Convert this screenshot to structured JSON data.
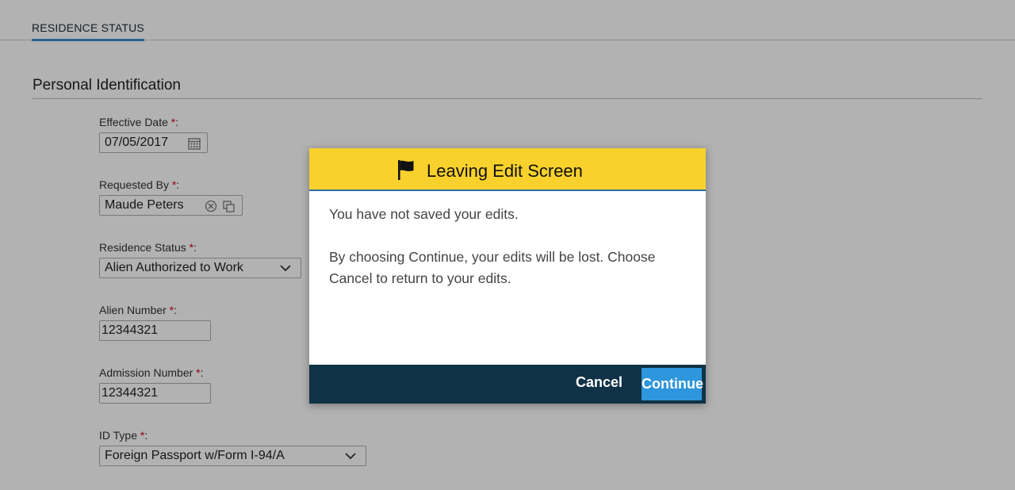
{
  "tabs": {
    "active": "RESIDENCE STATUS"
  },
  "section": {
    "title": "Personal Identification"
  },
  "form": {
    "effective_date": {
      "label": "Effective Date",
      "req": "*",
      "colon": ":",
      "value": "07/05/2017",
      "icon": "calendar-icon"
    },
    "requested_by": {
      "label": "Requested By",
      "req": "*",
      "colon": ":",
      "value": "Maude Peters",
      "icons": [
        "clear-icon",
        "lookup-icon"
      ]
    },
    "residence_status": {
      "label": "Residence Status",
      "req": "*",
      "colon": ":",
      "value": "Alien Authorized to Work",
      "icon": "chevron-down-icon"
    },
    "alien_number": {
      "label": "Alien Number",
      "req": "*",
      "colon": ":",
      "value": "12344321"
    },
    "admission_number": {
      "label": "Admission Number",
      "req": "*",
      "colon": ":",
      "value": "12344321"
    },
    "id_type": {
      "label": "ID Type",
      "req": "*",
      "colon": ":",
      "value": "Foreign Passport w/Form I-94/A",
      "icon": "chevron-down-icon"
    }
  },
  "colors": {
    "required_star": "#d0021b",
    "tab_underline": "#3a8fd0",
    "modal_header": "#f8d12c",
    "modal_footer": "#0f3246",
    "continue_button": "#2d96dc"
  },
  "modal": {
    "icon": "flag-icon",
    "title": "Leaving Edit Screen",
    "line1": "You have not saved your edits.",
    "line2": "By choosing Continue, your edits will be lost. Choose Cancel to return to your edits.",
    "cancel_label": "Cancel",
    "continue_label": "Continue"
  }
}
